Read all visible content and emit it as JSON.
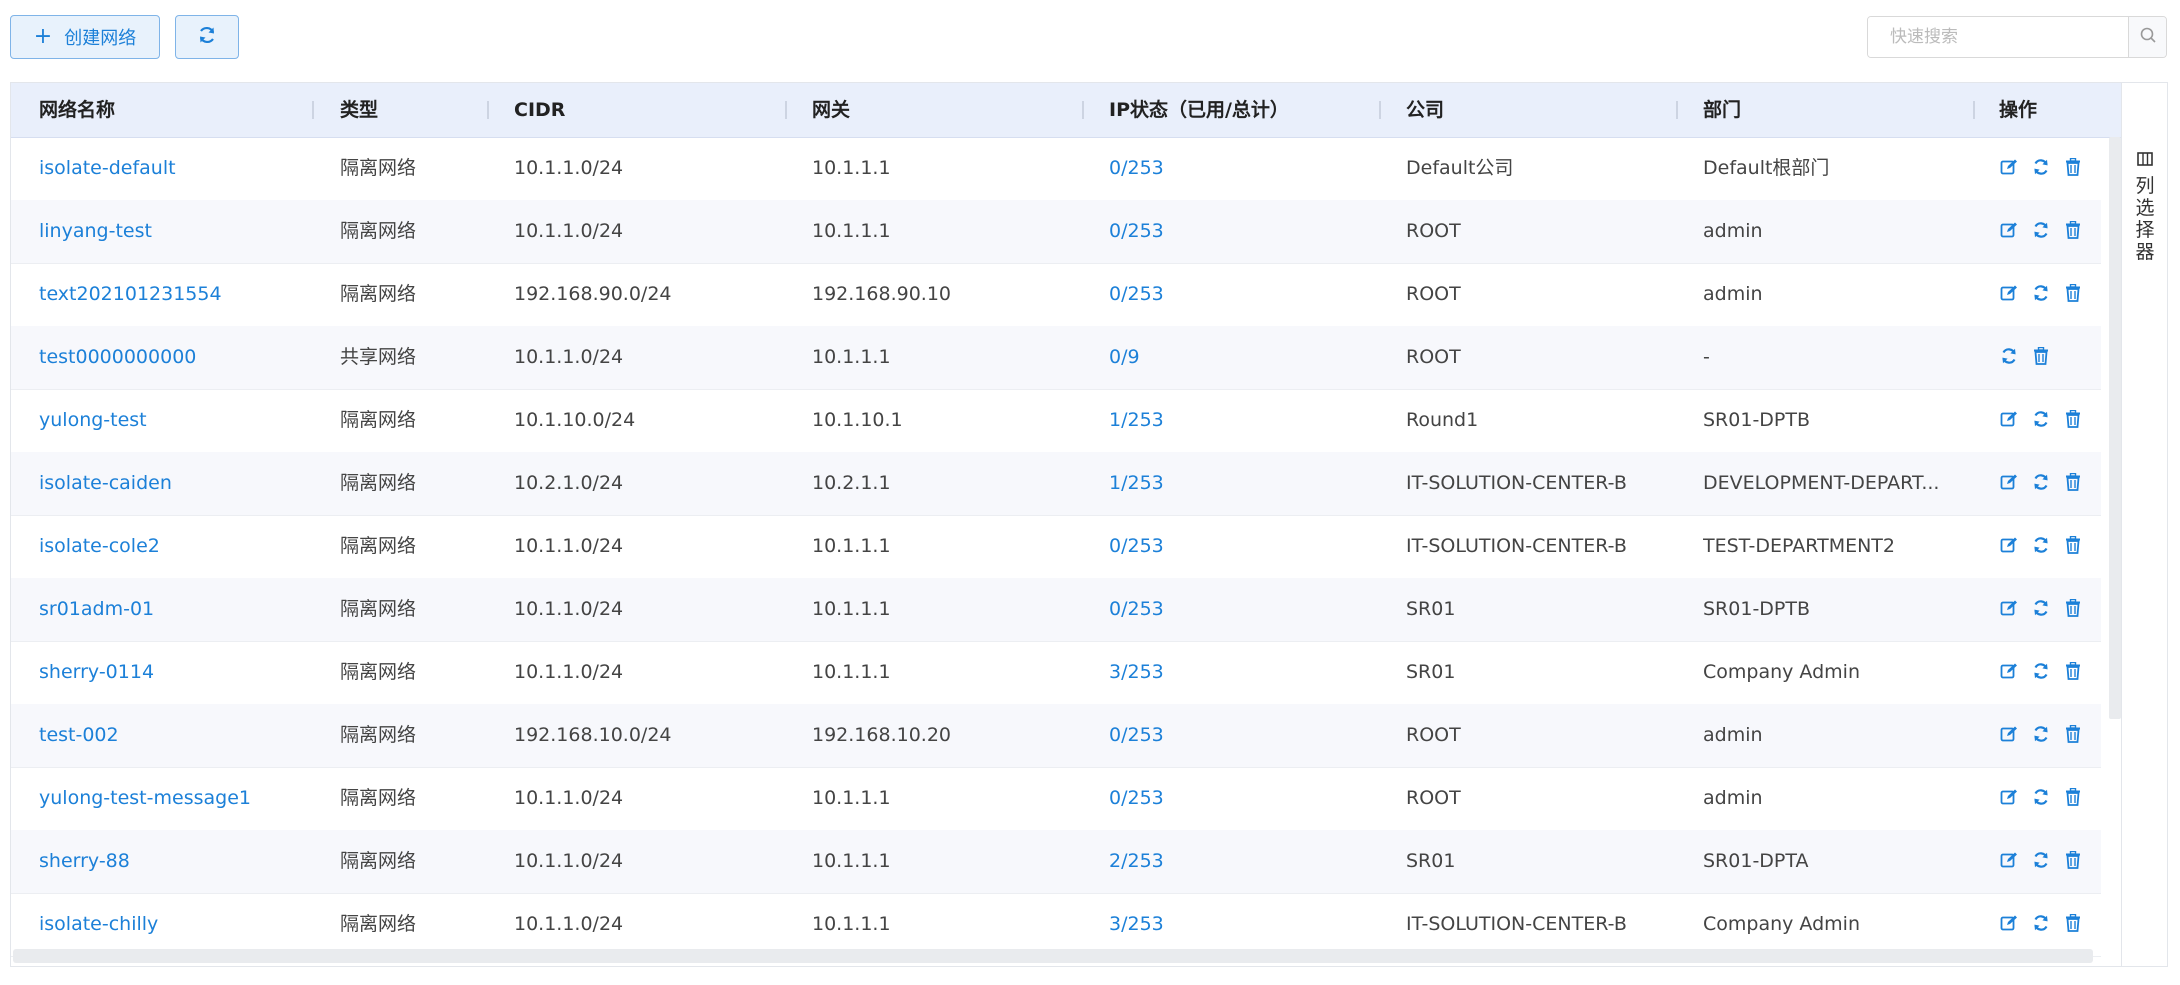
{
  "toolbar": {
    "create_label": "创建网络",
    "search_placeholder": "快速搜索"
  },
  "table": {
    "headers": {
      "name": "网络名称",
      "type": "类型",
      "cidr": "CIDR",
      "gateway": "网关",
      "ip_status": "IP状态（已用/总计）",
      "company": "公司",
      "department": "部门",
      "actions": "操作"
    },
    "rows": [
      {
        "name": "isolate-default",
        "type": "隔离网络",
        "cidr": "10.1.1.0/24",
        "gateway": "10.1.1.1",
        "ip_status": "0/253",
        "company": "Default公司",
        "department": "Default根部门"
      },
      {
        "name": "linyang-test",
        "type": "隔离网络",
        "cidr": "10.1.1.0/24",
        "gateway": "10.1.1.1",
        "ip_status": "0/253",
        "company": "ROOT",
        "department": "admin"
      },
      {
        "name": "text202101231554",
        "type": "隔离网络",
        "cidr": "192.168.90.0/24",
        "gateway": "192.168.90.10",
        "ip_status": "0/253",
        "company": "ROOT",
        "department": "admin"
      },
      {
        "name": "test0000000000",
        "type": "共享网络",
        "cidr": "10.1.1.0/24",
        "gateway": "10.1.1.1",
        "ip_status": "0/9",
        "company": "ROOT",
        "department": "-"
      },
      {
        "name": "yulong-test",
        "type": "隔离网络",
        "cidr": "10.1.10.0/24",
        "gateway": "10.1.10.1",
        "ip_status": "1/253",
        "company": "Round1",
        "department": "SR01-DPTB"
      },
      {
        "name": "isolate-caiden",
        "type": "隔离网络",
        "cidr": "10.2.1.0/24",
        "gateway": "10.2.1.1",
        "ip_status": "1/253",
        "company": "IT-SOLUTION-CENTER-B",
        "department": "DEVELOPMENT-DEPART..."
      },
      {
        "name": "isolate-cole2",
        "type": "隔离网络",
        "cidr": "10.1.1.0/24",
        "gateway": "10.1.1.1",
        "ip_status": "0/253",
        "company": "IT-SOLUTION-CENTER-B",
        "department": "TEST-DEPARTMENT2"
      },
      {
        "name": "sr01adm-01",
        "type": "隔离网络",
        "cidr": "10.1.1.0/24",
        "gateway": "10.1.1.1",
        "ip_status": "0/253",
        "company": "SR01",
        "department": "SR01-DPTB"
      },
      {
        "name": "sherry-0114",
        "type": "隔离网络",
        "cidr": "10.1.1.0/24",
        "gateway": "10.1.1.1",
        "ip_status": "3/253",
        "company": "SR01",
        "department": "Company Admin"
      },
      {
        "name": "test-002",
        "type": "隔离网络",
        "cidr": "192.168.10.0/24",
        "gateway": "192.168.10.20",
        "ip_status": "0/253",
        "company": "ROOT",
        "department": "admin"
      },
      {
        "name": "yulong-test-message1",
        "type": "隔离网络",
        "cidr": "10.1.1.0/24",
        "gateway": "10.1.1.1",
        "ip_status": "0/253",
        "company": "ROOT",
        "department": "admin"
      },
      {
        "name": "sherry-88",
        "type": "隔离网络",
        "cidr": "10.1.1.0/24",
        "gateway": "10.1.1.1",
        "ip_status": "2/253",
        "company": "SR01",
        "department": "SR01-DPTA"
      },
      {
        "name": "isolate-chilly",
        "type": "隔离网络",
        "cidr": "10.1.1.0/24",
        "gateway": "10.1.1.1",
        "ip_status": "3/253",
        "company": "IT-SOLUTION-CENTER-B",
        "department": "Company Admin"
      }
    ]
  },
  "column_picker": {
    "label": "列选择器"
  },
  "colors": {
    "accent": "#1c80d8",
    "header_bg": "#e9effb",
    "alt_row": "#f7f8fc"
  }
}
